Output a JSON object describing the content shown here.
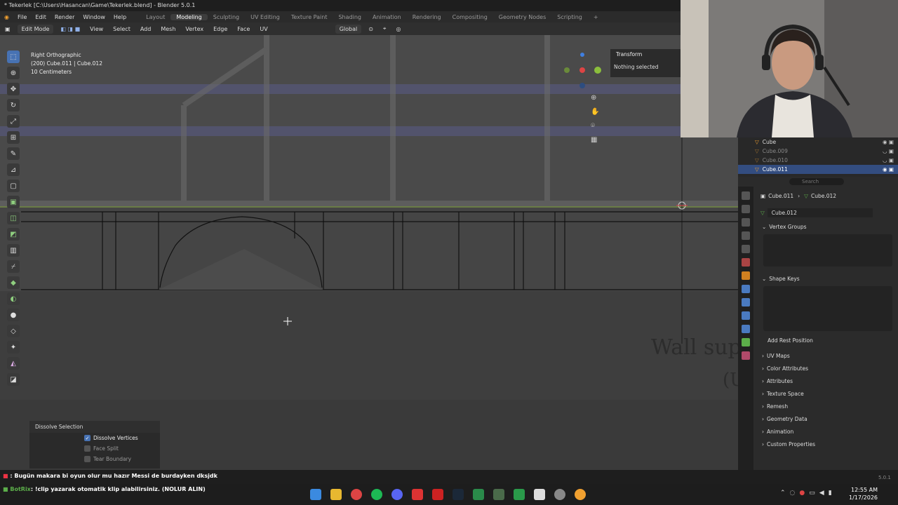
{
  "title": "* Tekerlek [C:\\Users\\Hasancan\\Game\\Tekerlek.blend] - Blender 5.0.1",
  "menus": [
    "File",
    "Edit",
    "Render",
    "Window",
    "Help"
  ],
  "workspaces": [
    "Layout",
    "Modeling",
    "Sculpting",
    "UV Editing",
    "Texture Paint",
    "Shading",
    "Animation",
    "Rendering",
    "Compositing",
    "Geometry Nodes",
    "Scripting",
    "+"
  ],
  "active_workspace": "Modeling",
  "toolbar": {
    "mode": "Edit Mode",
    "items": [
      "View",
      "Select",
      "Add",
      "Mesh",
      "Vertex",
      "Edge",
      "Face",
      "UV"
    ],
    "orientation": "Global"
  },
  "viewport": {
    "view_name": "Right Orthographic",
    "object_info": "(200) Cube.011 | Cube.012",
    "scale": "10 Centimeters",
    "watermark_text": "Wall sup",
    "watermark_text2": "(U"
  },
  "transform_panel": {
    "title": "Transform",
    "status": "Nothing selected"
  },
  "operator_panel": {
    "title": "Dissolve Selection",
    "options": [
      {
        "label": "Dissolve Vertices",
        "checked": true
      },
      {
        "label": "Face Split",
        "checked": false
      },
      {
        "label": "Tear Boundary",
        "checked": false
      }
    ]
  },
  "outliner": {
    "items": [
      {
        "name": "Cube",
        "state": "normal"
      },
      {
        "name": "Cube.009",
        "state": "dim"
      },
      {
        "name": "Cube.010",
        "state": "dim"
      },
      {
        "name": "Cube.011",
        "state": "selected"
      }
    ]
  },
  "properties": {
    "search_placeholder": "Search",
    "breadcrumb_object": "Cube.011",
    "breadcrumb_mesh": "Cube.012",
    "mesh_name": "Cube.012",
    "panels_open": [
      "Vertex Groups",
      "Shape Keys"
    ],
    "add_rest_position": "Add Rest Position",
    "sections": [
      "UV Maps",
      "Color Attributes",
      "Attributes",
      "Texture Space",
      "Remesh",
      "Geometry Data",
      "Animation",
      "Custom Properties"
    ]
  },
  "chat": [
    {
      "user": "",
      "text": ": Bugün makara bi oyun olur mu hazır Messi de burdayken dksjdk"
    },
    {
      "user": "BotRix",
      "text": ": !clip yazarak otomatik klip alabilirsiniz. (NOLUR ALIN)"
    }
  ],
  "version": "5.0.1",
  "clock": {
    "time": "12:55 AM",
    "date": "1/17/2026"
  },
  "colors": {
    "accent": "#4772b3",
    "selected_row": "#334d80",
    "edit_line": "#000000"
  }
}
